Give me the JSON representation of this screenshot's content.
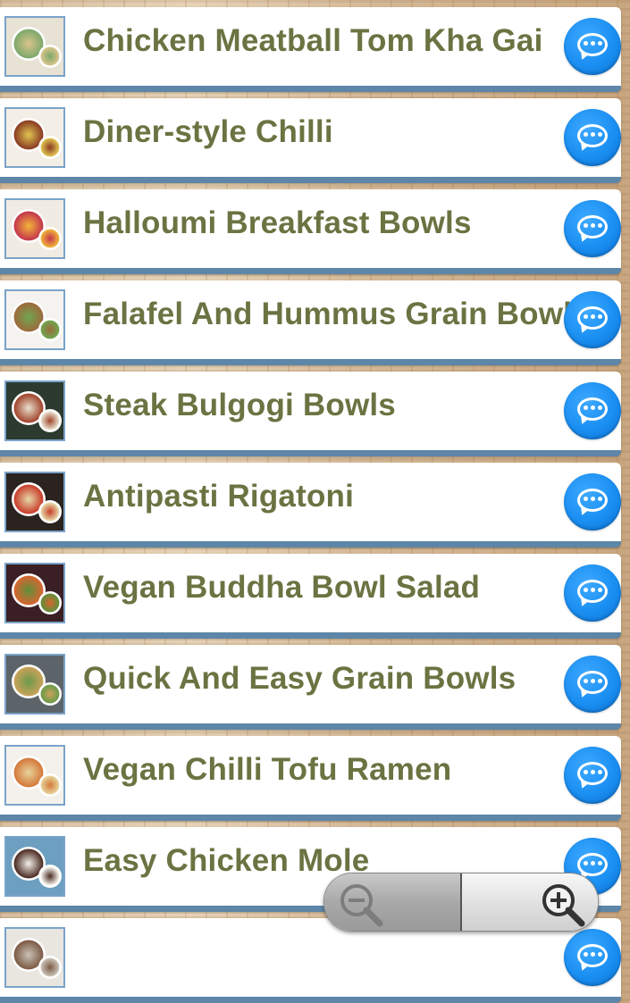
{
  "recipes": [
    {
      "title": "Chicken Meatball Tom Kha Gai",
      "thumb_colors": [
        "#e8e2d5",
        "#7da86b",
        "#d9c48a"
      ]
    },
    {
      "title": "Diner-style Chilli",
      "thumb_colors": [
        "#f3efe6",
        "#8a3b22",
        "#e0c452"
      ]
    },
    {
      "title": "Halloumi Breakfast Bowls",
      "thumb_colors": [
        "#f0ece4",
        "#c4364d",
        "#f2b53a"
      ]
    },
    {
      "title": "Falafel And Hummus Grain Bowl",
      "thumb_colors": [
        "#f5f3ef",
        "#9c6a3c",
        "#6fa64f"
      ]
    },
    {
      "title": "Steak Bulgogi Bowls",
      "thumb_colors": [
        "#2d3a2f",
        "#a0432b",
        "#e9e1cf"
      ]
    },
    {
      "title": "Antipasti Rigatoni",
      "thumb_colors": [
        "#2b2320",
        "#c93c2a",
        "#e6d8a8"
      ]
    },
    {
      "title": "Vegan Buddha Bowl Salad",
      "thumb_colors": [
        "#3a1f24",
        "#d8652f",
        "#5f8f3a"
      ]
    },
    {
      "title": "Quick And Easy Grain Bowls",
      "thumb_colors": [
        "#5c6469",
        "#c9a25a",
        "#6b9a4a"
      ]
    },
    {
      "title": "Vegan Chilli Tofu Ramen",
      "thumb_colors": [
        "#f4f1ec",
        "#d4793a",
        "#e7d39a"
      ]
    },
    {
      "title": "Easy Chicken Mole",
      "thumb_colors": [
        "#6d9fc0",
        "#4a2a22",
        "#f2f0ea"
      ]
    },
    {
      "title": "",
      "thumb_colors": [
        "#e9e6e0",
        "#7c5a45",
        "#c9c2b6"
      ]
    }
  ],
  "icons": {
    "chat_button": "chat-bubble-icon",
    "zoom_out": "zoom-out-icon",
    "zoom_in": "zoom-in-icon"
  },
  "colors": {
    "title_text": "#6b7342",
    "row_border": "#5d86a8",
    "chat_blue": "#1a8ff2"
  }
}
